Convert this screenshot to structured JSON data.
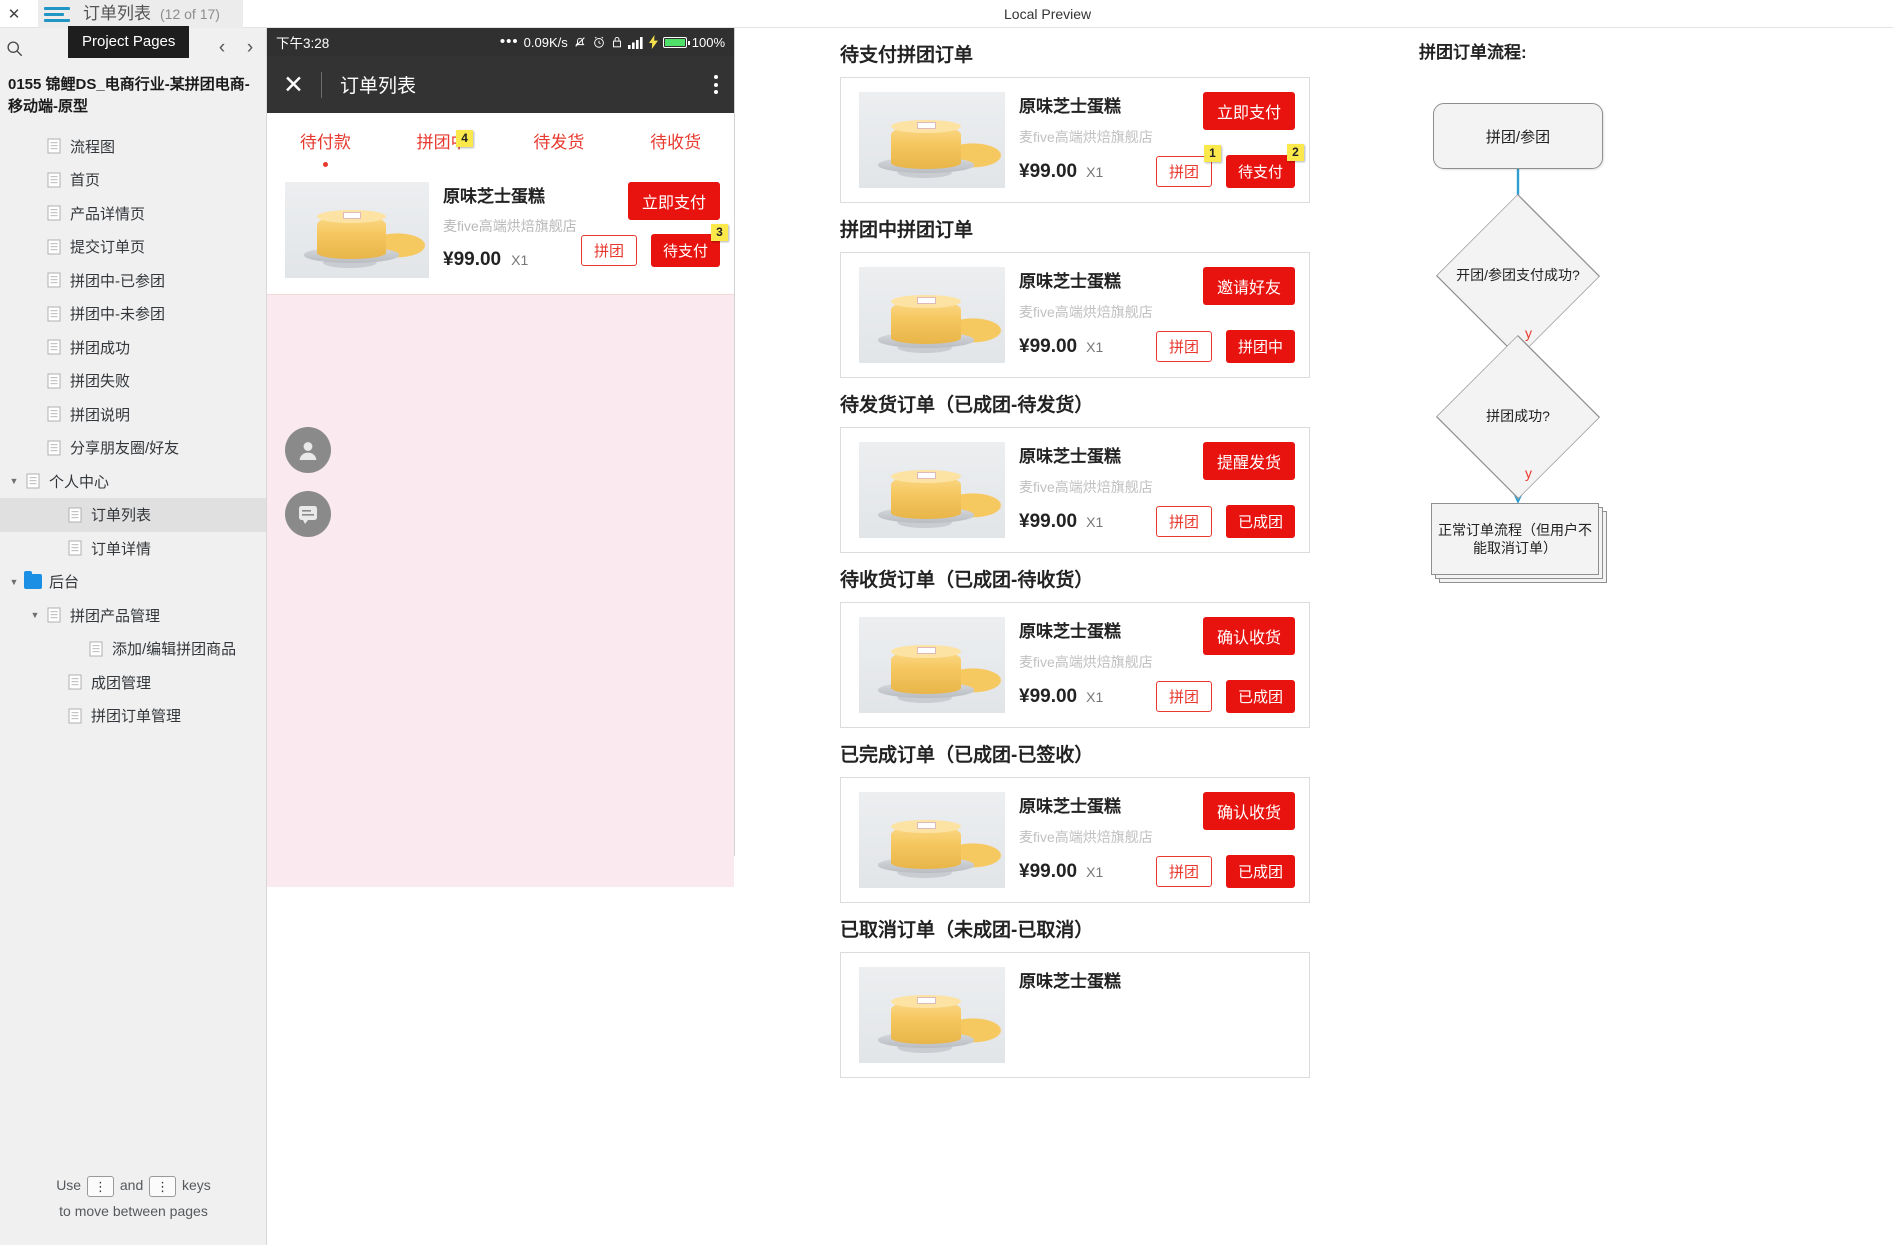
{
  "window": {
    "close_label": "✕",
    "page_title": "订单列表",
    "page_count": "(12 of 17)",
    "tooltip": "Project Pages",
    "preview_label": "Local Preview"
  },
  "sidebar": {
    "search_icon": "search-icon",
    "prev_label": "‹",
    "next_label": "›",
    "project_title": "0155 锦鲤DS_电商行业-某拼团电商-移动端-原型",
    "items": [
      {
        "label": "流程图",
        "indent": 1,
        "icon": "page",
        "twisty": "",
        "selected": false
      },
      {
        "label": "首页",
        "indent": 1,
        "icon": "page",
        "twisty": "",
        "selected": false
      },
      {
        "label": "产品详情页",
        "indent": 1,
        "icon": "page",
        "twisty": "",
        "selected": false
      },
      {
        "label": "提交订单页",
        "indent": 1,
        "icon": "page",
        "twisty": "",
        "selected": false
      },
      {
        "label": "拼团中-已参团",
        "indent": 1,
        "icon": "page",
        "twisty": "",
        "selected": false
      },
      {
        "label": "拼团中-未参团",
        "indent": 1,
        "icon": "page",
        "twisty": "",
        "selected": false
      },
      {
        "label": "拼团成功",
        "indent": 1,
        "icon": "page",
        "twisty": "",
        "selected": false
      },
      {
        "label": "拼团失败",
        "indent": 1,
        "icon": "page",
        "twisty": "",
        "selected": false
      },
      {
        "label": "拼团说明",
        "indent": 1,
        "icon": "page",
        "twisty": "",
        "selected": false
      },
      {
        "label": "分享朋友圈/好友",
        "indent": 1,
        "icon": "page",
        "twisty": "",
        "selected": false
      },
      {
        "label": "个人中心",
        "indent": 0,
        "icon": "page",
        "twisty": "▼",
        "selected": false
      },
      {
        "label": "订单列表",
        "indent": 2,
        "icon": "page",
        "twisty": "",
        "selected": true
      },
      {
        "label": "订单详情",
        "indent": 2,
        "icon": "page",
        "twisty": "",
        "selected": false
      },
      {
        "label": "后台",
        "indent": 0,
        "icon": "folder",
        "twisty": "▼",
        "selected": false
      },
      {
        "label": "拼团产品管理",
        "indent": 1,
        "icon": "page",
        "twisty": "▼",
        "selected": false
      },
      {
        "label": "添加/编辑拼团商品",
        "indent": 3,
        "icon": "page",
        "twisty": "",
        "selected": false
      },
      {
        "label": "成团管理",
        "indent": 2,
        "icon": "page",
        "twisty": "",
        "selected": false
      },
      {
        "label": "拼团订单管理",
        "indent": 2,
        "icon": "page",
        "twisty": "",
        "selected": false
      }
    ],
    "hint_line1_pre": "Use",
    "hint_key1": "⋮",
    "hint_and": "and",
    "hint_key2": "⋮",
    "hint_line1_post": "keys",
    "hint_line2": "to move between pages"
  },
  "phone": {
    "status": {
      "time": "下午3:28",
      "dots": "•••",
      "speed": "0.09K/s",
      "mute_icon": "bell-muted-icon",
      "alarm_icon": "alarm-icon",
      "lock_icon": "lock-icon",
      "signal_icon": "signal-icon",
      "bolt_icon": "bolt-icon",
      "battery": "100%"
    },
    "appbar": {
      "close": "✕",
      "title": "订单列表",
      "more_icon": "more-vertical-icon"
    },
    "tabs": [
      {
        "label": "待付款",
        "active": true,
        "badge": ""
      },
      {
        "label": "拼团中",
        "active": false,
        "badge": "4"
      },
      {
        "label": "待发货",
        "active": false,
        "badge": ""
      },
      {
        "label": "待收货",
        "active": false,
        "badge": ""
      }
    ],
    "order": {
      "name": "原味芝士蛋糕",
      "shop": "麦five高端烘焙旗舰店",
      "price": "¥99.00",
      "qty": "X1",
      "primary_btn": "立即支付",
      "tag_btn": "拼团",
      "status_btn": "待支付",
      "status_badge": "3"
    },
    "fab_avatar_icon": "user-avatar-icon",
    "fab_comment_icon": "comment-icon"
  },
  "panel": {
    "sections": [
      {
        "title": "待支付拼团订单",
        "name": "原味芝士蛋糕",
        "shop": "麦five高端烘焙旗舰店",
        "price": "¥99.00",
        "qty": "X1",
        "primary_btn": "立即支付",
        "tag_btn": "拼团",
        "tag_badge": "1",
        "status_btn": "待支付",
        "status_badge": "2"
      },
      {
        "title": "拼团中拼团订单",
        "name": "原味芝士蛋糕",
        "shop": "麦five高端烘焙旗舰店",
        "price": "¥99.00",
        "qty": "X1",
        "primary_btn": "邀请好友",
        "tag_btn": "拼团",
        "tag_badge": "",
        "status_btn": "拼团中",
        "status_badge": ""
      },
      {
        "title": "待发货订单（已成团-待发货）",
        "name": "原味芝士蛋糕",
        "shop": "麦five高端烘焙旗舰店",
        "price": "¥99.00",
        "qty": "X1",
        "primary_btn": "提醒发货",
        "tag_btn": "拼团",
        "tag_badge": "",
        "status_btn": "已成团",
        "status_badge": ""
      },
      {
        "title": "待收货订单（已成团-待收货）",
        "name": "原味芝士蛋糕",
        "shop": "麦five高端烘焙旗舰店",
        "price": "¥99.00",
        "qty": "X1",
        "primary_btn": "确认收货",
        "tag_btn": "拼团",
        "tag_badge": "",
        "status_btn": "已成团",
        "status_badge": ""
      },
      {
        "title": "已完成订单（已成团-已签收）",
        "name": "原味芝士蛋糕",
        "shop": "麦five高端烘焙旗舰店",
        "price": "¥99.00",
        "qty": "X1",
        "primary_btn": "确认收货",
        "tag_btn": "拼团",
        "tag_badge": "",
        "status_btn": "已成团",
        "status_badge": ""
      },
      {
        "title": "已取消订单（未成团-已取消）",
        "name": "原味芝士蛋糕",
        "shop": "",
        "price": "",
        "qty": "",
        "primary_btn": "",
        "tag_btn": "",
        "tag_badge": "",
        "status_btn": "",
        "status_badge": ""
      }
    ]
  },
  "flow": {
    "title": "拼团订单流程:",
    "node_start": "拼团/参团",
    "decision1": "开团/参团支付成功?",
    "decision2": "拼团成功?",
    "end_node": "正常订单流程（但用户不能取消订单）",
    "yes1": "y",
    "yes2": "y"
  },
  "colors": {
    "accent_red": "#e8130f",
    "tab_red": "#e8392e",
    "badge_yellow": "#fbe94b",
    "phone_bg": "#fae9ee",
    "appbar_dark": "#333333",
    "status_dark": "#303030",
    "folder_blue": "#1a8fe3"
  }
}
